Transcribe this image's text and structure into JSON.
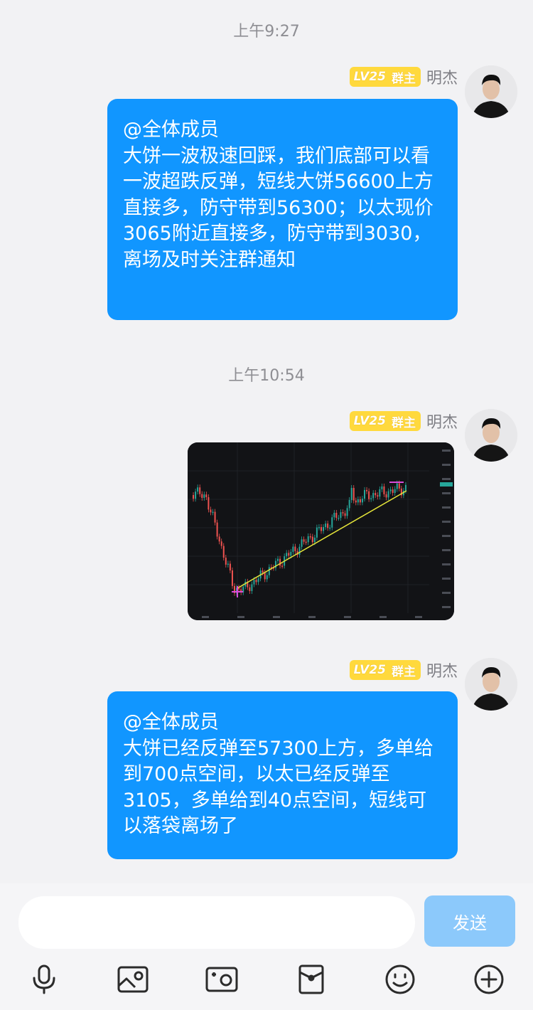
{
  "timestamps": [
    "上午9:27",
    "上午10:54"
  ],
  "sender": {
    "level": "LV25",
    "role": "群主",
    "name": "明杰"
  },
  "messages": [
    {
      "mention": "@全体成员",
      "body": "大饼一波极速回踩，我们底部可以看一波超跌反弹，短线大饼56600上方直接多，防守带到56300；以太现价3065附近直接多，防守带到3030，离场及时关注群通知"
    },
    {
      "mention": "@全体成员",
      "body": "大饼已经反弹至57300上方，多单给到700点空间，以太已经反弹至3105，多单给到40点空间，短线可以落袋离场了"
    }
  ],
  "composer": {
    "input_placeholder": "",
    "send_label": "发送"
  },
  "toolbar": [
    "microphone-icon",
    "photo-icon",
    "camera-icon",
    "red-packet-icon",
    "emoji-icon",
    "plus-icon"
  ],
  "colors": {
    "bubble": "#1196ff",
    "send_disabled": "#8cc9fb",
    "badge": "#ffd93d",
    "chart_bg": "#121316",
    "candle_up": "#26a69a",
    "candle_down": "#ef5350",
    "trendline": "#e6e63a"
  }
}
